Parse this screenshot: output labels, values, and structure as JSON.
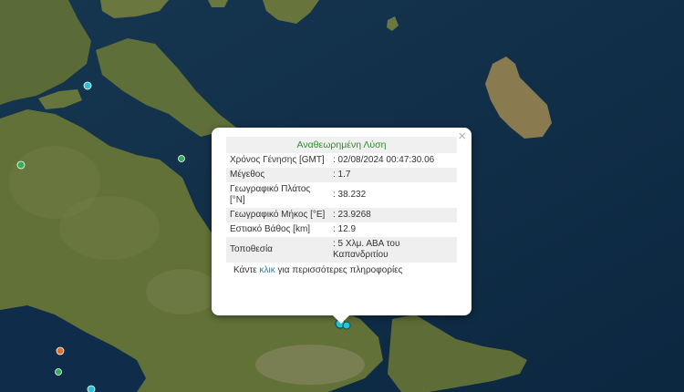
{
  "popup": {
    "title": "Αναθεωρημένη Λύση",
    "close_label": "×",
    "rows": [
      {
        "label": "Χρόνος Γένησης [GMT]",
        "value": ": 02/08/2024 00:47:30.06"
      },
      {
        "label": "Μέγεθος",
        "value": ": 1.7"
      },
      {
        "label": "Γεωγραφικό Πλάτος [°N]",
        "value": ": 38.232"
      },
      {
        "label": "Γεωγραφικό Μήκος [°E]",
        "value": ": 23.9268"
      },
      {
        "label": "Εστιακό Βάθος [km]",
        "value": ": 12.9"
      },
      {
        "label": "Τοποθεσία",
        "value": ": 5 Χλμ. ΑΒΑ του Καπανδριτίου"
      }
    ],
    "more_prefix": "Κάντε ",
    "more_link": "κλικ",
    "more_suffix": " για περισσότερες πληροφορίες"
  },
  "colors": {
    "sea": "#0d2a44",
    "land": "#5e6e3a",
    "marker_cyan": "#27c3d3",
    "marker_green": "#2eb05a",
    "marker_orange": "#e0702a",
    "popup_title": "#2e8b2e",
    "link": "#1a7fbf"
  }
}
